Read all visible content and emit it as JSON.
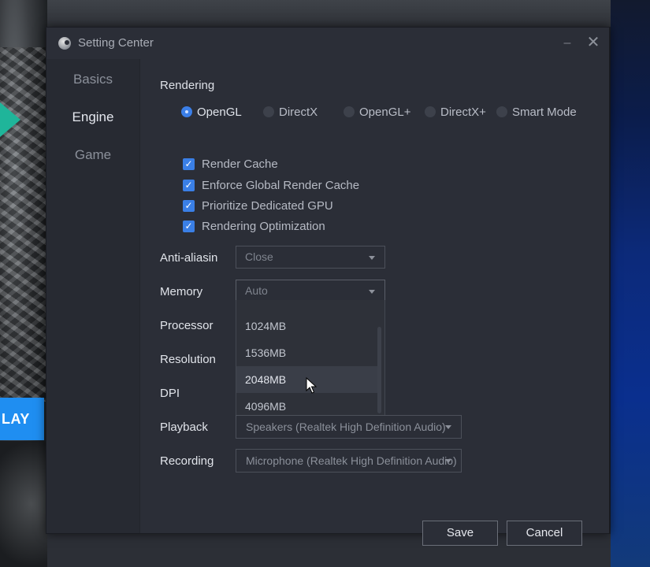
{
  "window": {
    "title": "Setting Center",
    "minimize_label": "–",
    "close_label": "✕"
  },
  "background": {
    "play_button_label": "LAY"
  },
  "sidebar": {
    "items": [
      {
        "label": "Basics",
        "active": false
      },
      {
        "label": "Engine",
        "active": true
      },
      {
        "label": "Game",
        "active": false
      }
    ]
  },
  "rendering": {
    "title": "Rendering",
    "modes": [
      {
        "label": "OpenGL",
        "selected": true
      },
      {
        "label": "DirectX",
        "selected": false
      },
      {
        "label": "OpenGL+",
        "selected": false
      },
      {
        "label": "DirectX+",
        "selected": false
      },
      {
        "label": "Smart Mode",
        "selected": false
      }
    ],
    "options": [
      {
        "label": "Render Cache",
        "checked": true
      },
      {
        "label": "Enforce Global Render Cache",
        "checked": true
      },
      {
        "label": "Prioritize Dedicated GPU",
        "checked": true
      },
      {
        "label": "Rendering Optimization",
        "checked": true
      }
    ]
  },
  "fields": {
    "anti_aliasing": {
      "label": "Anti-aliasing",
      "value": "Close"
    },
    "memory": {
      "label": "Memory",
      "value": "Auto"
    },
    "processor": {
      "label": "Processor"
    },
    "resolution": {
      "label": "Resolution"
    },
    "dpi": {
      "label": "DPI"
    },
    "playback": {
      "label": "Playback",
      "value": "Speakers (Realtek High Definition Audio)"
    },
    "recording": {
      "label": "Recording",
      "value": "Microphone (Realtek High Definition Audio)"
    }
  },
  "memory_dropdown": {
    "options": [
      "1024MB",
      "1536MB",
      "2048MB",
      "4096MB"
    ],
    "hovered": "2048MB"
  },
  "buttons": {
    "save": "Save",
    "cancel": "Cancel"
  },
  "colors": {
    "accent": "#3b7fe8",
    "dialog_bg": "#2b2e37",
    "play_button": "#1f8ef1"
  }
}
